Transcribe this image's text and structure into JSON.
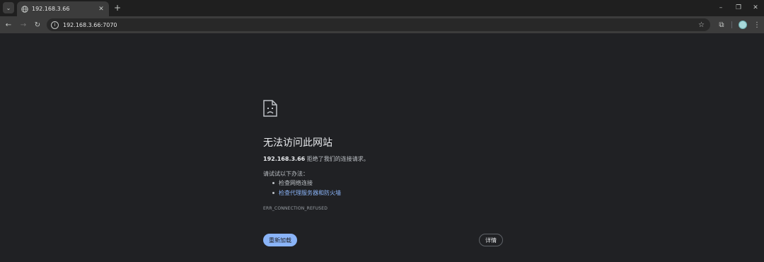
{
  "browser": {
    "tab": {
      "title": "192.168.3.66",
      "close_glyph": "✕"
    },
    "new_tab_glyph": "+",
    "window_controls": {
      "minimize": "–",
      "restore": "❐",
      "close": "✕"
    },
    "tab_search_glyph": "⌄",
    "toolbar": {
      "back": "←",
      "forward": "→",
      "reload": "↻",
      "url": "192.168.3.66:7070",
      "star": "☆",
      "extensions": "⧉",
      "menu": "⋮"
    }
  },
  "error": {
    "title": "无法访问此网站",
    "host": "192.168.3.66",
    "description_suffix": " 拒绝了我们的连接请求。",
    "try_label": "请试试以下办法：",
    "suggestions": [
      {
        "text": "检查网络连接",
        "link": false
      },
      {
        "text": "检查代理服务器和防火墙",
        "link": true
      }
    ],
    "code": "ERR_CONNECTION_REFUSED",
    "reload_label": "重新加载",
    "details_label": "详情"
  },
  "colors": {
    "page_bg": "#202124",
    "accent": "#8ab4f8",
    "text": "#e8eaed",
    "muted": "#bdc1c6"
  }
}
